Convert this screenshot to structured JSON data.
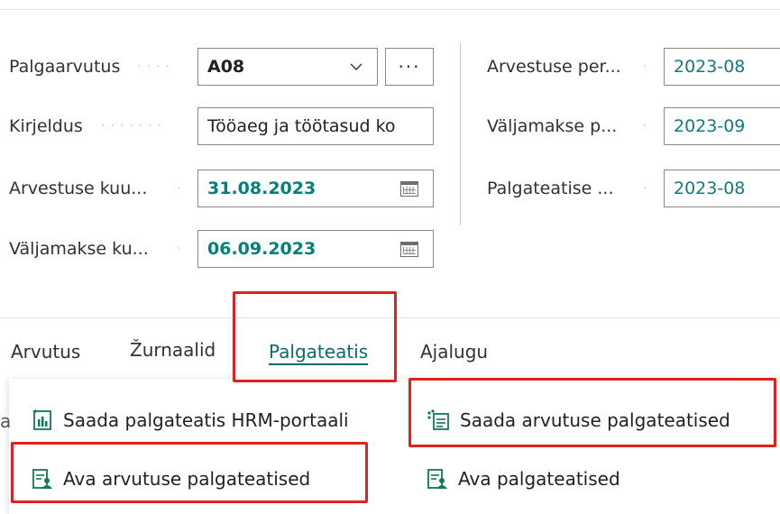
{
  "fields": {
    "payroll": {
      "label": "Palgaarvutus",
      "value": "A08"
    },
    "description": {
      "label": "Kirjeldus",
      "value": "Tööaeg ja töötasud ko"
    },
    "calc_month": {
      "label": "Arvestuse kuu...",
      "value": "31.08.2023"
    },
    "payout_month": {
      "label": "Väljamakse ku...",
      "value": "06.09.2023"
    },
    "calc_period": {
      "label": "Arvestuse per...",
      "value": "2023-08"
    },
    "payout_period": {
      "label": "Väljamakse p...",
      "value": "2023-09"
    },
    "payslip_period": {
      "label": "Palgateatise ...",
      "value": "2023-08"
    }
  },
  "lookup_button": {
    "label": "···"
  },
  "tabs": [
    {
      "label": "Arvutus"
    },
    {
      "label": "Žurnaalid"
    },
    {
      "label": "Palgateatis"
    },
    {
      "label": "Ajalugu"
    }
  ],
  "actions": {
    "send_hrm": "Saada palgateatis HRM-portaali",
    "send_calc_payslips": "Saada arvutuse palgateatised",
    "open_calc_payslips": "Ava arvutuse palgateatised",
    "open_payslips": "Ava palgateatised"
  },
  "edge_letter": "a",
  "colors": {
    "accent": "#00827a",
    "highlight": "#e2201c"
  }
}
